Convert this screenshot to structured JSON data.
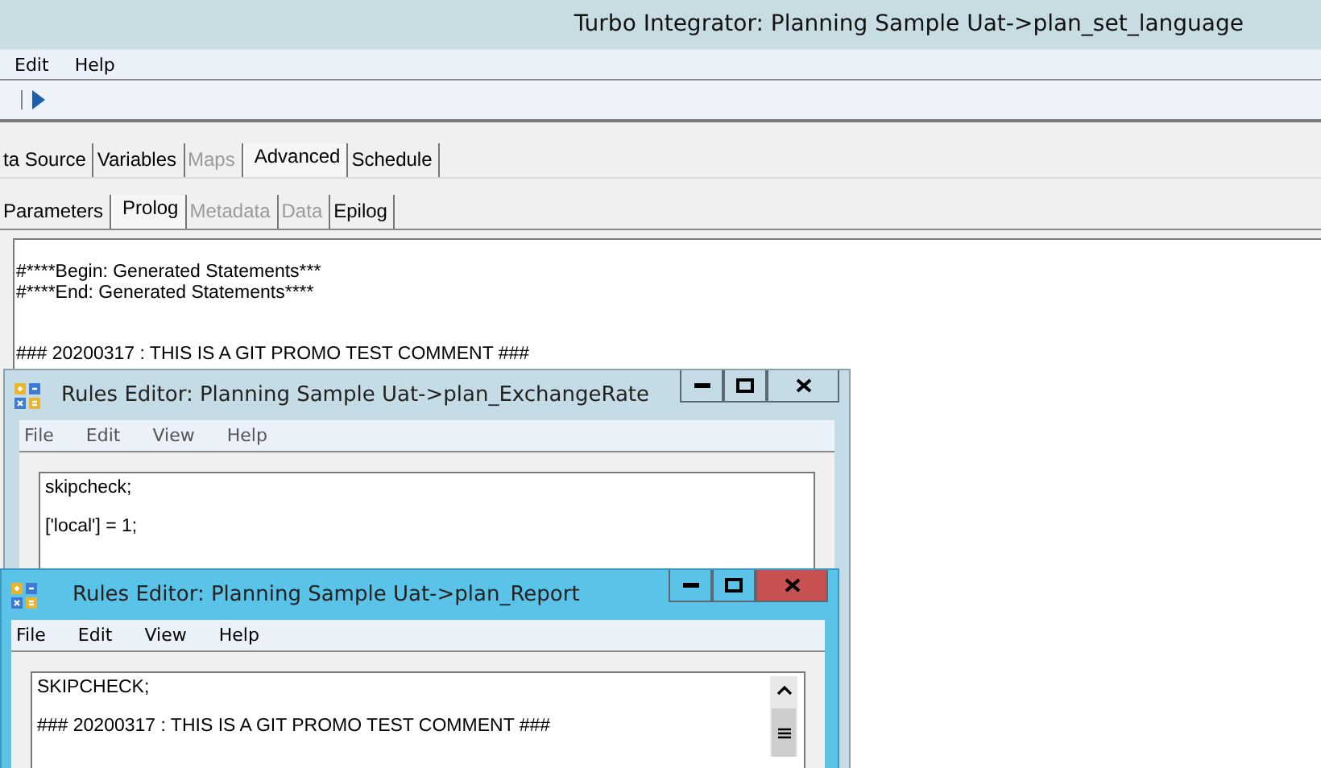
{
  "window": {
    "title": "Turbo Integrator:  Planning Sample Uat->plan_set_language"
  },
  "menu": [
    "Edit",
    "Help"
  ],
  "tabs": [
    {
      "label": "ta Source",
      "selected": false,
      "disabled": false
    },
    {
      "label": "Variables",
      "selected": false,
      "disabled": false
    },
    {
      "label": "Maps",
      "selected": false,
      "disabled": true
    },
    {
      "label": "Advanced",
      "selected": true,
      "disabled": false
    },
    {
      "label": "Schedule",
      "selected": false,
      "disabled": false
    }
  ],
  "subtabs": [
    {
      "label": "Parameters",
      "selected": false,
      "disabled": false
    },
    {
      "label": "Prolog",
      "selected": true,
      "disabled": false
    },
    {
      "label": "Metadata",
      "selected": false,
      "disabled": true
    },
    {
      "label": "Data",
      "selected": false,
      "disabled": true
    },
    {
      "label": "Epilog",
      "selected": false,
      "disabled": false
    }
  ],
  "editor": {
    "lines": [
      "#****Begin: Generated Statements***",
      "#****End: Generated Statements****",
      "### 20200317 : THIS IS A GIT PROMO TEST COMMENT ###"
    ]
  },
  "dialogs": [
    {
      "title": "Rules Editor:  Planning Sample Uat->plan_ExchangeRate",
      "active": false,
      "menu": [
        "File",
        "Edit",
        "View",
        "Help"
      ],
      "lines": [
        "skipcheck;",
        "['local'] = 1;"
      ],
      "scrollbar": false
    },
    {
      "title": "Rules Editor:  Planning Sample Uat->plan_Report",
      "active": true,
      "menu": [
        "File",
        "Edit",
        "View",
        "Help"
      ],
      "lines": [
        "SKIPCHECK;",
        "### 20200317 : THIS IS A GIT PROMO TEST COMMENT ###"
      ],
      "scrollbar": true
    }
  ]
}
